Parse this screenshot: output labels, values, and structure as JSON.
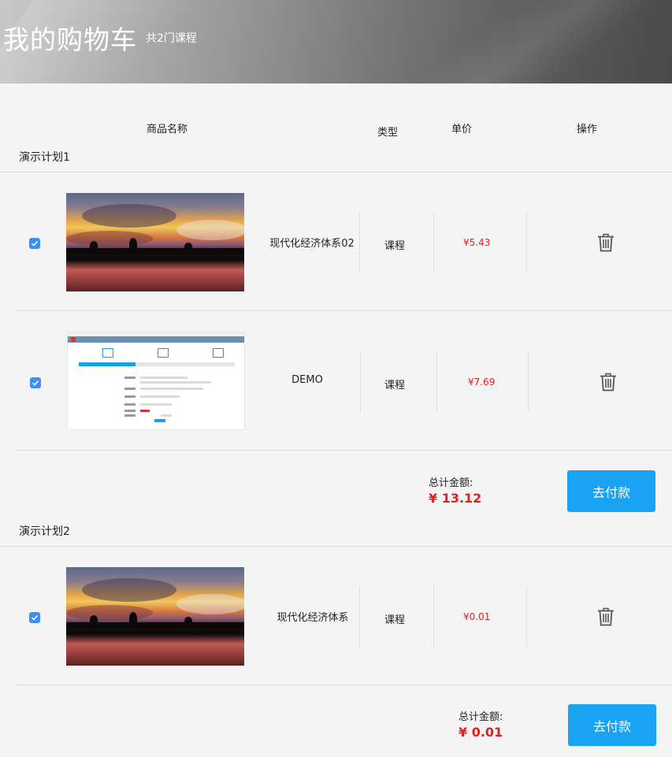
{
  "header": {
    "title": "我的购物车",
    "course_count": "共2门课程"
  },
  "columns": {
    "name": "商品名称",
    "type": "类型",
    "price": "单价",
    "action": "操作"
  },
  "groups": [
    {
      "title": "演示计划1",
      "items": [
        {
          "checked": true,
          "thumbnail": "sunset-photo",
          "name": "现代化经济体系02",
          "type": "课程",
          "price": "¥5.43",
          "delete_icon": "trash-icon"
        },
        {
          "checked": true,
          "thumbnail": "form-screenshot",
          "name": "DEMO",
          "type": "课程",
          "price": "¥7.69",
          "delete_icon": "trash-icon"
        }
      ],
      "total_label": "总计金额:",
      "total_value": "¥ 13.12",
      "pay_label": "去付款"
    },
    {
      "title": "演示计划2",
      "items": [
        {
          "checked": true,
          "thumbnail": "sunset-photo",
          "name": "现代化经济体系",
          "type": "课程",
          "price": "¥0.01",
          "delete_icon": "trash-icon"
        }
      ],
      "total_label": "总计金额:",
      "total_value": "¥ 0.01",
      "pay_label": "去付款"
    }
  ],
  "colors": {
    "accent": "#1aa3f2",
    "price": "#e02020",
    "checkbox": "#3d8ef7"
  }
}
